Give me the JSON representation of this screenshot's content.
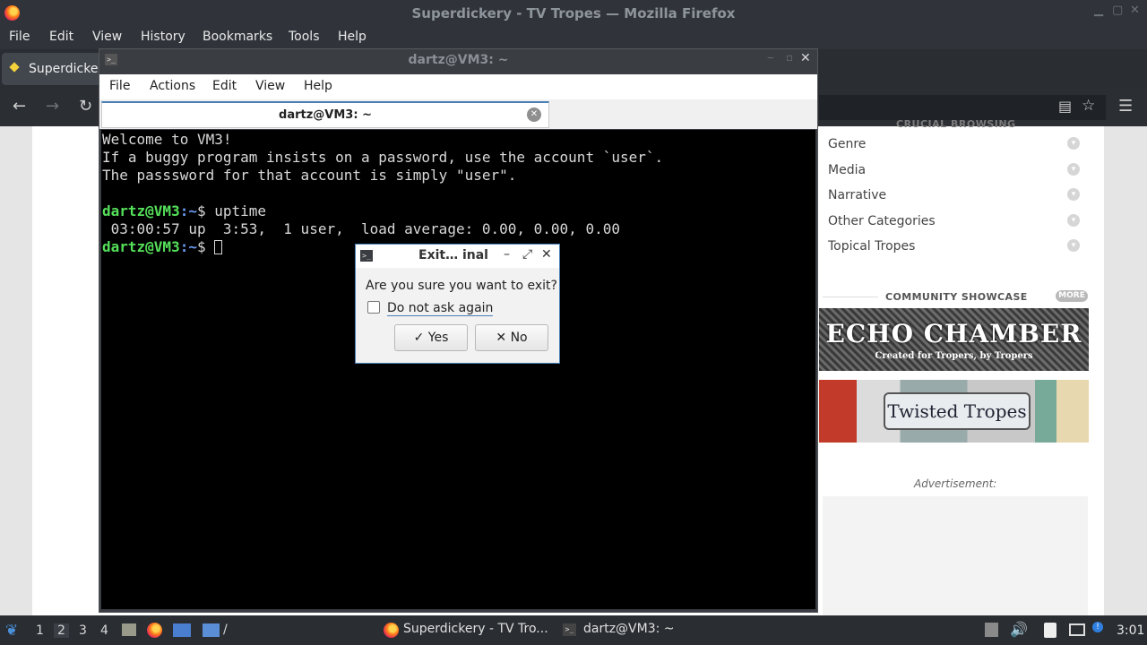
{
  "firefox": {
    "window_title": "Superdickery - TV Tropes — Mozilla Firefox",
    "menu": [
      "File",
      "Edit",
      "View",
      "History",
      "Bookmarks",
      "Tools",
      "Help"
    ],
    "tab_label": "Superdicker",
    "icons": {
      "back": "back-arrow-icon",
      "forward": "forward-arrow-icon",
      "reload": "reload-icon",
      "reader": "reader-view-icon",
      "bookmark": "star-icon",
      "menu": "hamburger-menu-icon"
    }
  },
  "page": {
    "sidebar_header": "CRUCIAL BROWSING",
    "sidebar_items": [
      "Genre",
      "Media",
      "Narrative",
      "Other Categories",
      "Topical Tropes"
    ],
    "showcase_title": "COMMUNITY SHOWCASE",
    "more_label": "MORE",
    "echo_chamber_title": "ECHO CHAMBER",
    "echo_chamber_sub": "Created for Tropers, by Tropers",
    "twisted_tropes": "Twisted Tropes",
    "advertisement": "Advertisement:"
  },
  "terminal": {
    "window_title": "dartz@VM3: ~",
    "menu": [
      "File",
      "Actions",
      "Edit",
      "View",
      "Help"
    ],
    "tab_label": "dartz@VM3: ~",
    "lines": {
      "l1": "Welcome to VM3!",
      "l2": "If a buggy program insists on a password, use the account `user`.",
      "l3": "The passsword for that account is simply \"user\".",
      "p1_user": "dartz@VM3",
      "p1_dir": ":~",
      "p1_cmd": "$ uptime",
      "l5": " 03:00:57 up  3:53,  1 user,  load average: 0.00, 0.00, 0.00",
      "p2_user": "dartz@VM3",
      "p2_dir": ":~",
      "p2_cmd": "$ "
    }
  },
  "dialog": {
    "title": "Exit… inal",
    "question": "Are you sure you want to exit?",
    "checkbox_label": "Do not ask again",
    "checkbox_checked": false,
    "yes_label": "Yes",
    "no_label": "No"
  },
  "taskbar": {
    "workspaces": [
      "1",
      "2",
      "3",
      "4"
    ],
    "active_workspace": "2",
    "path_label": "/",
    "tasks": [
      "Superdickery - TV Tro...",
      "dartz@VM3: ~"
    ],
    "clock": "3:01"
  }
}
